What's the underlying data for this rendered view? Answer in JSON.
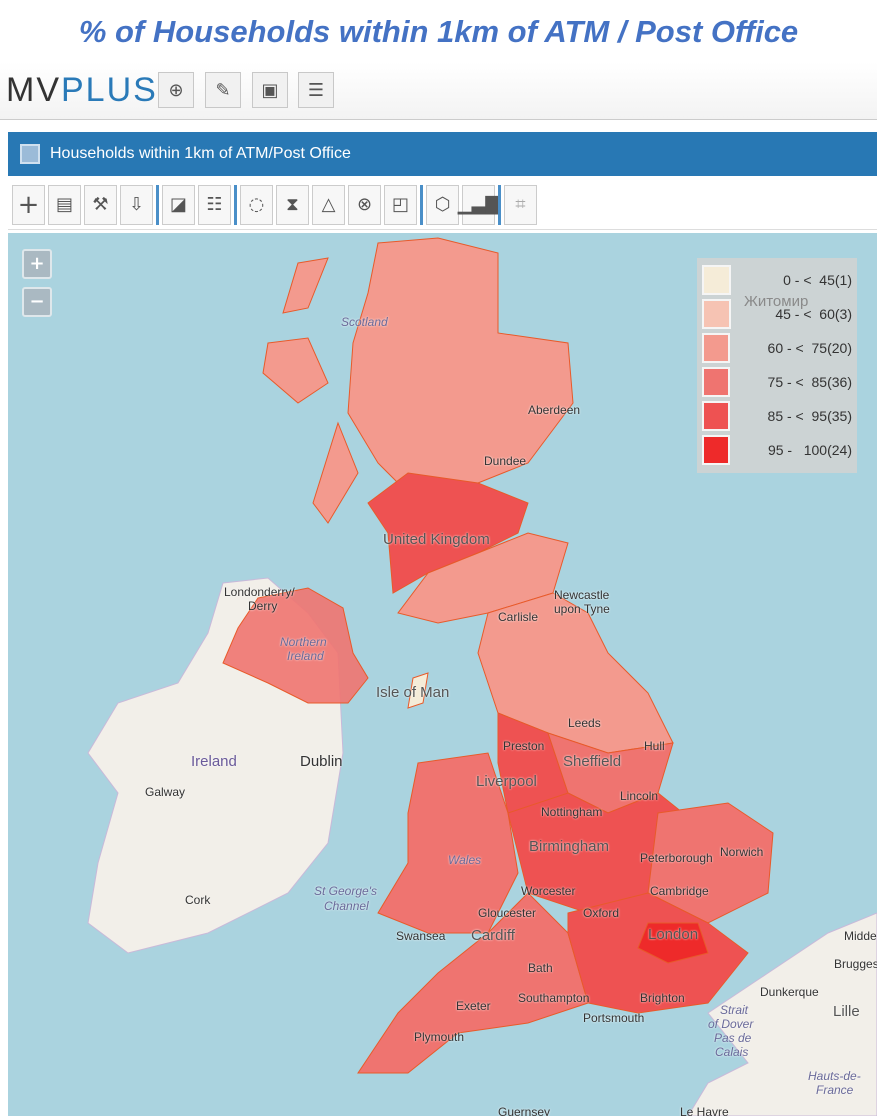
{
  "title": "% of Households within 1km of ATM / Post Office",
  "app": {
    "logo_mv": "MV",
    "logo_plus": "PLUS",
    "buttons": [
      "upload-icon",
      "edit-icon",
      "print-icon",
      "list-icon"
    ]
  },
  "panel": {
    "title": "Households within 1km of ATM/Post Office"
  },
  "toolbar": {
    "groups": [
      [
        "plus-icon",
        "save-icon",
        "wrench-icon",
        "download-icon"
      ],
      [
        "edit-layer-icon",
        "add-field-icon"
      ],
      [
        "filter-icon",
        "time-filter-icon",
        "road-filter-icon",
        "clear-selection-icon",
        "frame-icon"
      ],
      [
        "hexbin-icon",
        "bar-chart-icon"
      ],
      [
        "crop-icon"
      ]
    ]
  },
  "map": {
    "zoom_in": "+",
    "zoom_out": "−",
    "legend": [
      {
        "range": "0 - <  45",
        "count": "(1)",
        "color": "#f5ecd8"
      },
      {
        "range": "45 - <  60",
        "count": "(3)",
        "color": "#f6c3b3"
      },
      {
        "range": "60 - <  75",
        "count": "(20)",
        "color": "#f39a8e"
      },
      {
        "range": "75 - <  85",
        "count": "(36)",
        "color": "#ef7470"
      },
      {
        "range": "85 - <  95",
        "count": "(35)",
        "color": "#ee5252"
      },
      {
        "range": "95 -   100",
        "count": "(24)",
        "color": "#ee2a2a"
      }
    ],
    "labels": {
      "scotland": "Scotland",
      "aberdeen": "Aberdeen",
      "dundee": "Dundee",
      "uk": "United Kingdom",
      "newcastle": "Newcastle",
      "upon_tyne": "upon Tyne",
      "carlisle": "Carlisle",
      "londonderry": "Londonderry/",
      "derry": "Derry",
      "northern": "Northern",
      "ireland_ni": "Ireland",
      "isle_of_man": "Isle of Man",
      "ireland": "Ireland",
      "dublin": "Dublin",
      "galway": "Galway",
      "cork": "Cork",
      "leeds": "Leeds",
      "hull": "Hull",
      "preston": "Preston",
      "liverpool": "Liverpool",
      "sheffield": "Sheffield",
      "lincoln": "Lincoln",
      "nottingham": "Nottingham",
      "birmingham": "Birmingham",
      "peterborough": "Peterborough",
      "norwich": "Norwich",
      "cambridge": "Cambridge",
      "wales": "Wales",
      "worcester": "Worcester",
      "oxford": "Oxford",
      "gloucester": "Gloucester",
      "cardiff": "Cardiff",
      "swansea": "Swansea",
      "st_georges": "St George's",
      "channel": "Channel",
      "bath": "Bath",
      "london": "London",
      "southampton": "Southampton",
      "portsmouth": "Portsmouth",
      "brighton": "Brighton",
      "exeter": "Exeter",
      "plymouth": "Plymouth",
      "dunkerque": "Dunkerque",
      "lille": "Lille",
      "strait": "Strait",
      "of_dover": "of Dover",
      "pas_de": "Pas de",
      "calais": "Calais",
      "middelburg": "Midde",
      "brugge": "Brugges",
      "hauts": "Hauts-de-",
      "france": "France",
      "le_havre": "Le Havre",
      "guernsey": "Guernsey",
      "zhytomyr": "Житомир"
    }
  }
}
